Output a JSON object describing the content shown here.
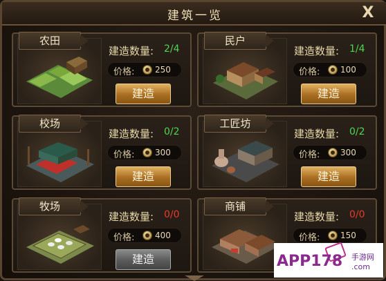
{
  "window": {
    "title": "建筑一览",
    "close_label": "X"
  },
  "labels": {
    "count": "建造数量:",
    "price": "价格:"
  },
  "buildings": [
    {
      "name": "农田",
      "count": "2/4",
      "count_color": "green",
      "price": "250",
      "button": "建造",
      "enabled": true
    },
    {
      "name": "民户",
      "count": "1/4",
      "count_color": "green",
      "price": "100",
      "button": "建造",
      "enabled": true
    },
    {
      "name": "校场",
      "count": "0/2",
      "count_color": "green",
      "price": "300",
      "button": "建造",
      "enabled": true
    },
    {
      "name": "工匠坊",
      "count": "0/2",
      "count_color": "green",
      "price": "300",
      "button": "建造",
      "enabled": true
    },
    {
      "name": "牧场",
      "count": "0/0",
      "count_color": "red",
      "price": "400",
      "button": "建造",
      "enabled": false
    },
    {
      "name": "商铺",
      "count": "0/0",
      "count_color": "red",
      "price": "150",
      "button": "",
      "enabled": false
    }
  ],
  "watermark": {
    "logo": "APP178",
    "line1": "手游网",
    "line2": ".com"
  },
  "colors": {
    "green": "#4fd64f",
    "red": "#e83a2a",
    "gold_button": "#c08a3a",
    "gray_button": "#6a6a6a"
  }
}
